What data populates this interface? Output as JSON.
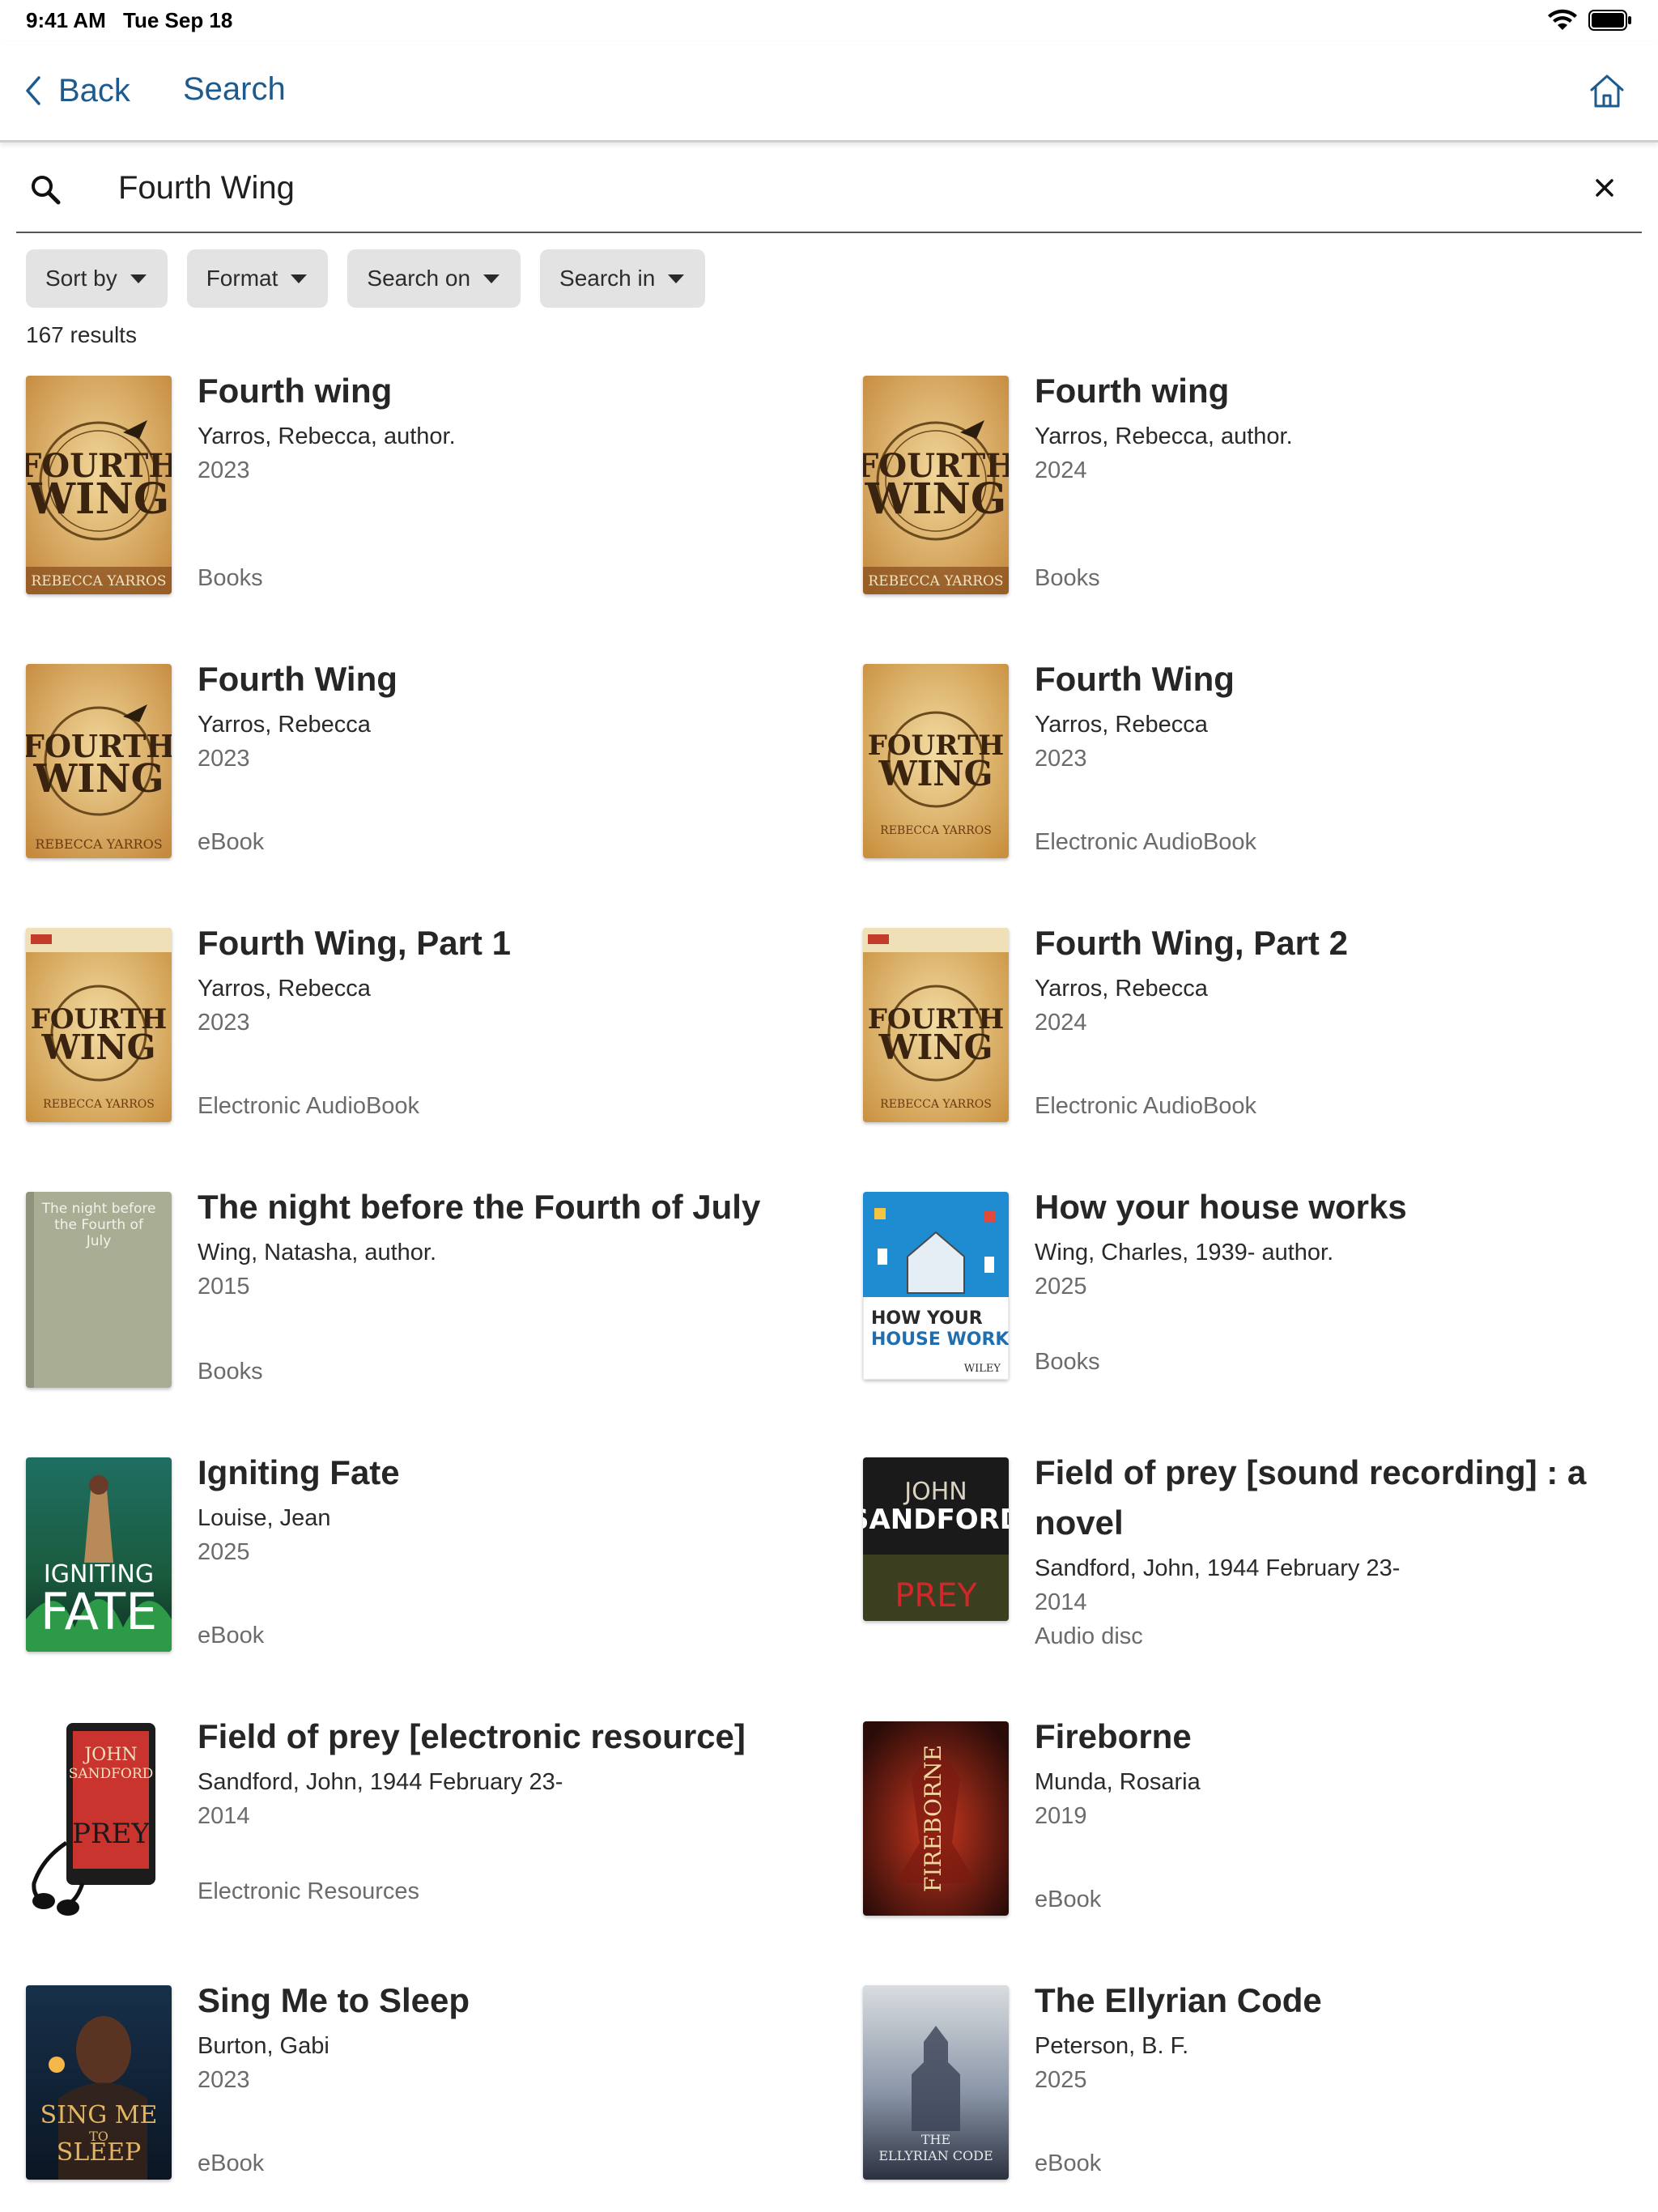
{
  "status": {
    "time": "9:41 AM",
    "date": "Tue Sep 18"
  },
  "nav": {
    "back_label": "Back",
    "title": "Search"
  },
  "search": {
    "query": "Fourth Wing"
  },
  "filters": [
    "Sort by",
    "Format",
    "Search on",
    "Search in"
  ],
  "result_count": "167 results",
  "results": [
    {
      "title": "Fourth wing",
      "author": "Yarros, Rebecca, author.",
      "year": "2023",
      "format": "Books"
    },
    {
      "title": "Fourth wing",
      "author": "Yarros, Rebecca, author.",
      "year": "2024",
      "format": "Books"
    },
    {
      "title": "Fourth Wing",
      "author": "Yarros, Rebecca",
      "year": "2023",
      "format": "eBook"
    },
    {
      "title": "Fourth Wing",
      "author": "Yarros, Rebecca",
      "year": "2023",
      "format": "Electronic AudioBook"
    },
    {
      "title": "Fourth Wing, Part 1",
      "author": "Yarros, Rebecca",
      "year": "2023",
      "format": "Electronic AudioBook"
    },
    {
      "title": "Fourth Wing, Part 2",
      "author": "Yarros, Rebecca",
      "year": "2024",
      "format": "Electronic AudioBook"
    },
    {
      "title": "The night before the Fourth of July",
      "author": "Wing, Natasha, author.",
      "year": "2015",
      "format": "Books",
      "cover_text": "The night before the Fourth of July"
    },
    {
      "title": "How your house works",
      "author": "Wing, Charles, 1939- author.",
      "year": "2025",
      "format": "Books",
      "cover_text": "HOW YOUR HOUSE WORKS"
    },
    {
      "title": "Igniting Fate",
      "author": "Louise, Jean",
      "year": "2025",
      "format": "eBook",
      "cover_text": "IGNITING FATE"
    },
    {
      "title": "Field of prey [sound recording] : a novel",
      "author": "Sandford, John, 1944 February 23-",
      "year": "2014",
      "format": "Audio disc",
      "cover_text": "JOHN SANDFORD"
    },
    {
      "title": "Field of prey [electronic resource]",
      "author": "Sandford, John, 1944 February 23-",
      "year": "2014",
      "format": "Electronic Resources"
    },
    {
      "title": "Fireborne",
      "author": "Munda, Rosaria",
      "year": "2019",
      "format": "eBook",
      "cover_text": "FIREBORNE"
    },
    {
      "title": "Sing Me to Sleep",
      "author": "Burton, Gabi",
      "year": "2023",
      "format": "eBook",
      "cover_text": "SING ME TO SLEEP"
    },
    {
      "title": "The Ellyrian Code",
      "author": "Peterson, B. F.",
      "year": "2025",
      "format": "eBook",
      "cover_text": "THE ELLYRIAN CODE"
    }
  ],
  "colors": {
    "accent": "#1d5a8e",
    "chip_bg": "#e3e3e3",
    "muted_text": "#6b6b6b"
  },
  "icons": {
    "back": "chevron-left-icon",
    "home": "home-icon",
    "search": "search-icon",
    "clear": "close-icon"
  }
}
